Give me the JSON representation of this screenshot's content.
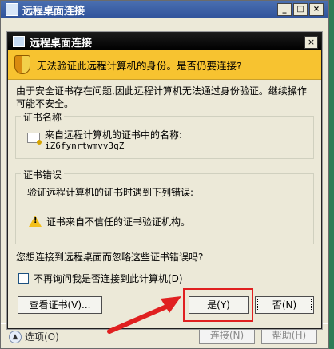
{
  "background_window": {
    "title": "远程桌面连接",
    "options_label": "选项(O)",
    "connect_label": "连接(N)",
    "help_label": "帮助(H)"
  },
  "dialog": {
    "title": "远程桌面连接",
    "warning": "无法验证此远程计算机的身份。是否仍要连接?",
    "description": "由于安全证书存在问题,因此远程计算机无法通过身份验证。继续操作可能不安全。",
    "cert_group": {
      "title": "证书名称",
      "label": "来自远程计算机的证书中的名称:",
      "value": "iZ6fynrtwmvv3qZ"
    },
    "error_group": {
      "title": "证书错误",
      "label": "验证远程计算机的证书时遇到下列错误:",
      "error_text": "证书来自不信任的证书验证机构。"
    },
    "question": "您想连接到远程桌面而忽略这些证书错误吗?",
    "checkbox_label": "不再询问我是否连接到此计算机(D)",
    "buttons": {
      "view_cert": "查看证书(V)...",
      "yes": "是(Y)",
      "no": "否(N)"
    }
  },
  "colors": {
    "warning_bar": "#f7c330",
    "highlight": "#e02020"
  }
}
